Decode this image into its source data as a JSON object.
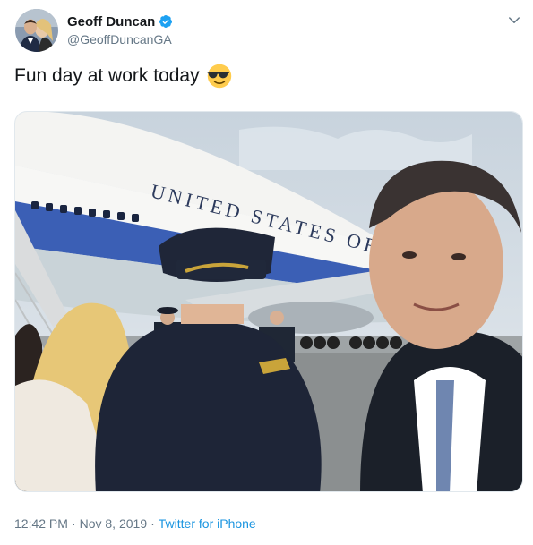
{
  "tweet": {
    "author": {
      "display_name": "Geoff Duncan",
      "handle": "@GeoffDuncanGA",
      "verified": true,
      "avatar_icon": "profile-photo"
    },
    "text": "Fun day at work today",
    "emoji": "smiling-face-with-sunglasses",
    "meta": {
      "time": "12:42 PM",
      "separator": "·",
      "date": "Nov 8, 2019",
      "source": "Twitter for iPhone"
    },
    "media": {
      "aircraft_lettering": "UNITED STATES OF"
    }
  },
  "colors": {
    "link": "#1b95e0",
    "verified": "#1da1f2",
    "secondary_text": "#657786"
  }
}
